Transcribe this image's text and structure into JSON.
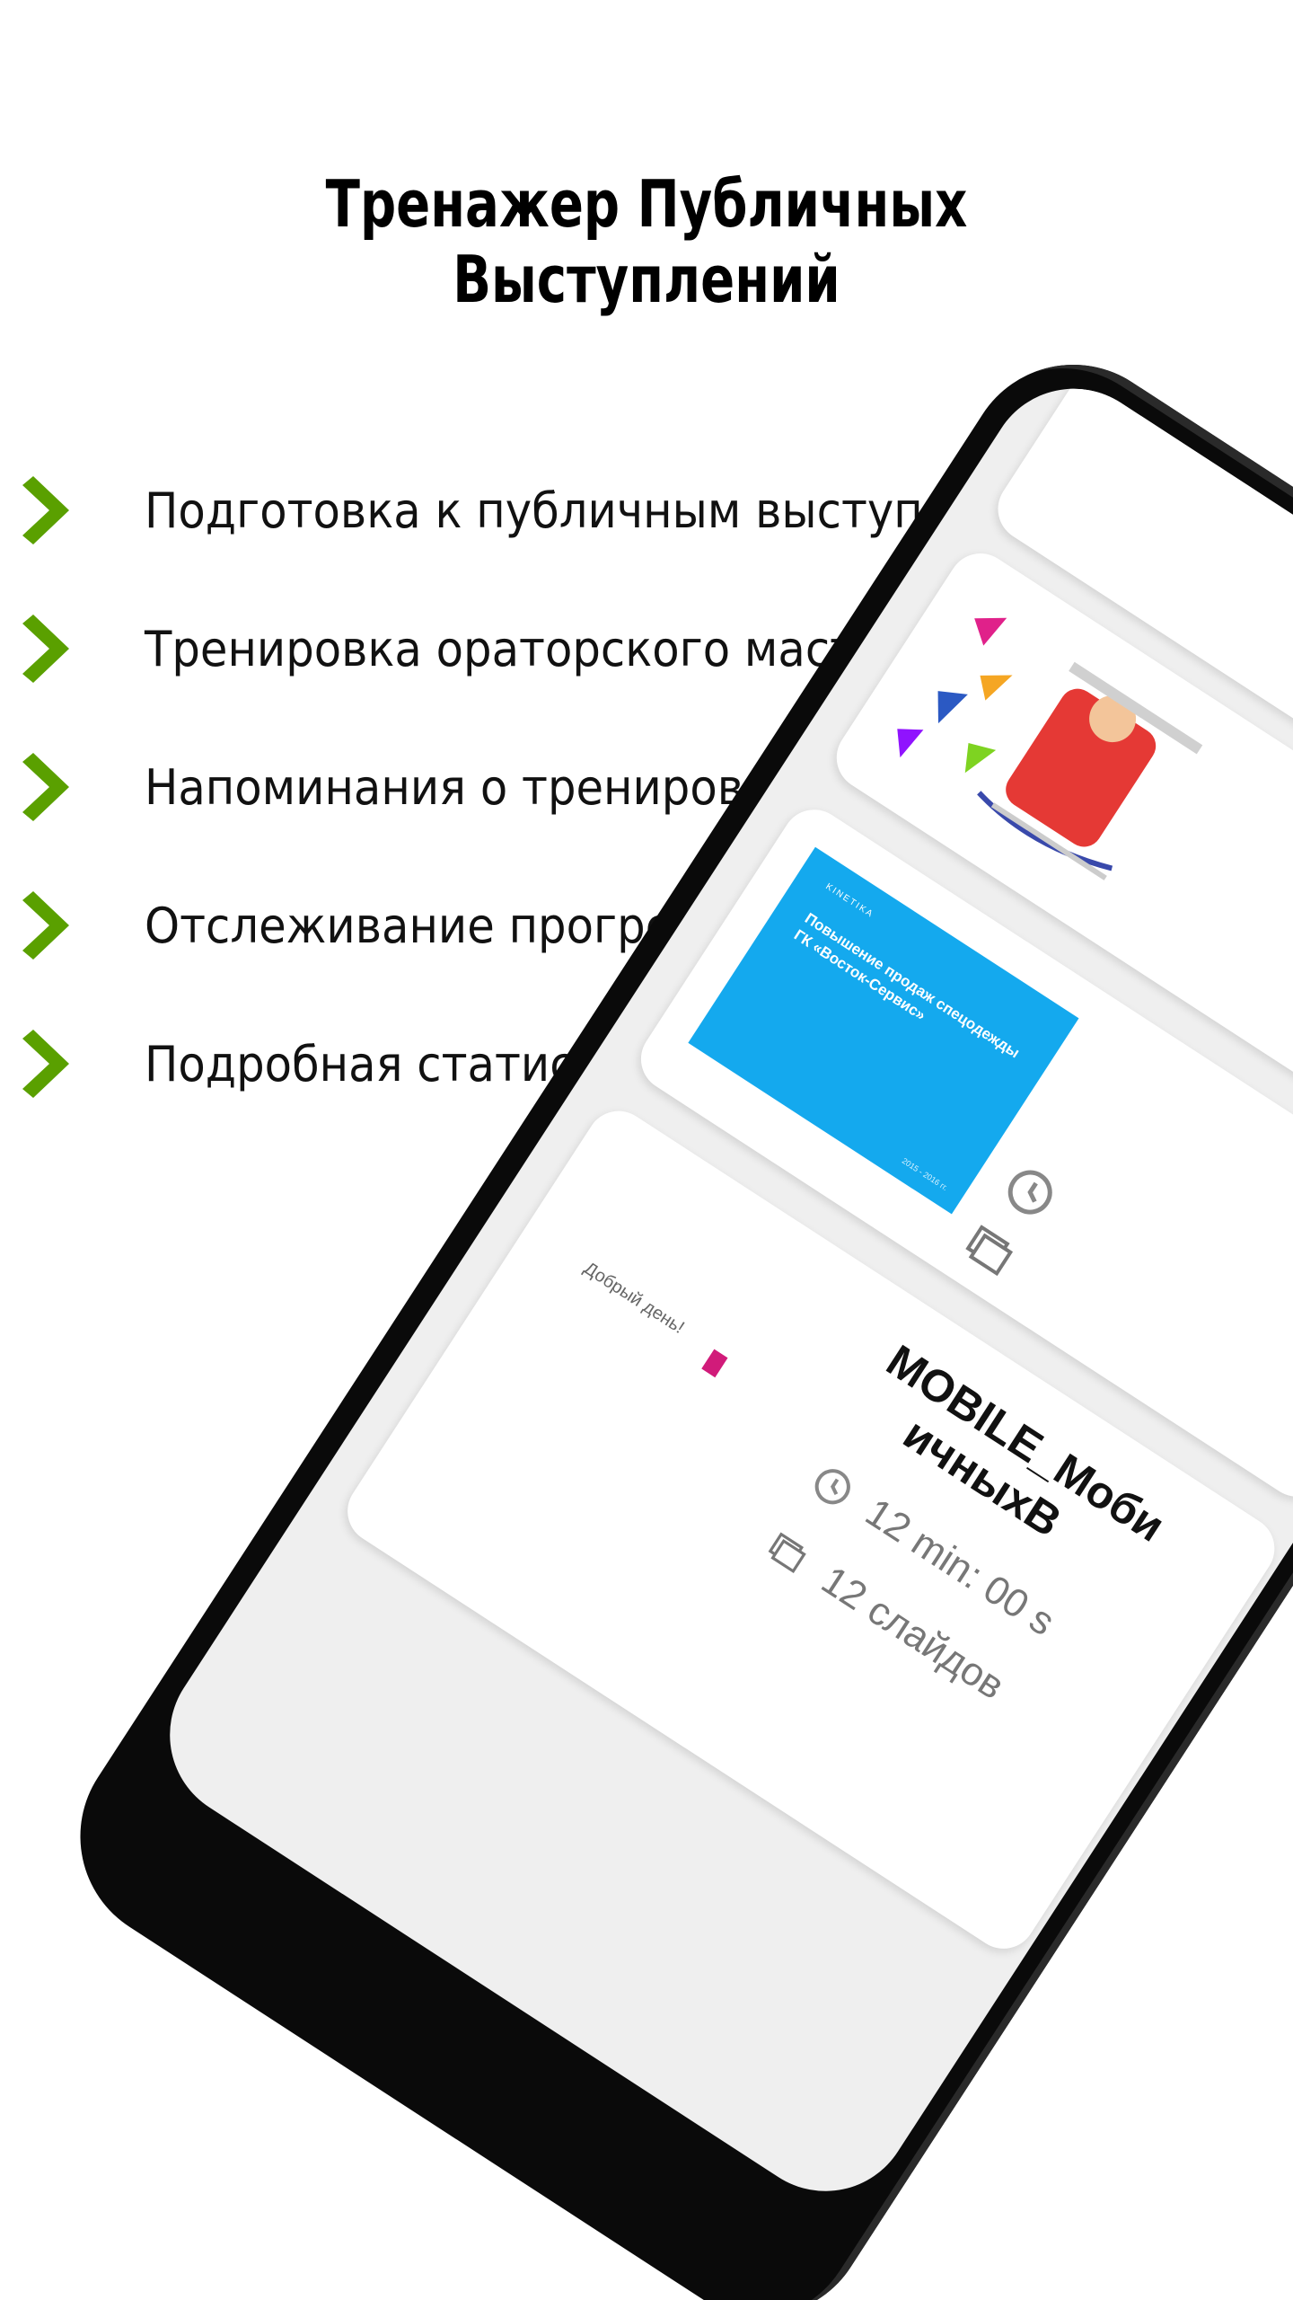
{
  "app": {
    "headline": "Тренажер Публичных Выступлений"
  },
  "features": [
    {
      "label": "Подготовка к публичным выступлениям",
      "icon": "chevron-right-icon"
    },
    {
      "label": "Тренировка ораторского мастерства",
      "icon": "chevron-right-icon"
    },
    {
      "label": "Напоминания о тренировках",
      "icon": "chevron-right-icon"
    },
    {
      "label": "Отслеживание прогресса",
      "icon": "chevron-right-icon"
    },
    {
      "label": "Подробная статистика",
      "icon": "chevron-right-icon"
    }
  ],
  "colors": {
    "accent": "#5aa000",
    "blue_slide": "#14a9ee",
    "phone_body": "#0a0a0a"
  },
  "phone": {
    "cards": [
      {
        "thumbnail": "kids-sled-slide"
      },
      {
        "thumbnail": "blue-slide",
        "slide_title": "Повышение продаж спецодежды ГК «Восток-Сервис»",
        "slide_brand": "KINETIKA",
        "slide_footer": "2015 - 2016 гг."
      },
      {
        "thumbnail": "greeting-slide",
        "slide_greeting": "Добрый день!",
        "title_line1": "MOBILE_Моби",
        "title_line2": "ичныхВ",
        "duration": "12 min: 00 s",
        "slides": "12 слайдов"
      }
    ]
  }
}
